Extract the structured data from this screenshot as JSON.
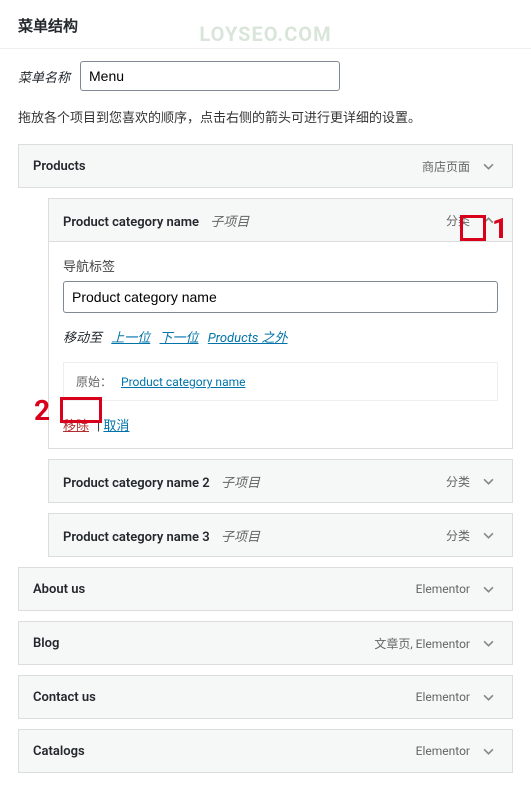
{
  "watermark": "LOYSEO.COM",
  "header": {
    "title": "菜单结构"
  },
  "menuNameLabel": "菜单名称",
  "menuNameValue": "Menu",
  "instructions": "拖放各个项目到您喜欢的顺序，点击右侧的箭头可进行更详细的设置。",
  "items": [
    {
      "title": "Products",
      "type": "商店页面",
      "depth": 0,
      "expanded": false
    },
    {
      "title": "Product category name",
      "subLabel": "子项目",
      "type": "分类",
      "depth": 1,
      "expanded": true,
      "settings": {
        "navLabel": "导航标签",
        "navValue": "Product category name",
        "moveLabel": "移动至",
        "moveLinks": [
          "上一位",
          "下一位",
          "Products 之外"
        ],
        "originalLabel": "原始：",
        "originalLink": "Product category name",
        "removeText": "移除",
        "cancelText": "取消"
      }
    },
    {
      "title": "Product category name 2",
      "subLabel": "子项目",
      "type": "分类",
      "depth": 1,
      "expanded": false
    },
    {
      "title": "Product category name 3",
      "subLabel": "子项目",
      "type": "分类",
      "depth": 1,
      "expanded": false
    },
    {
      "title": "About us",
      "type": "Elementor",
      "depth": 0,
      "expanded": false
    },
    {
      "title": "Blog",
      "type": "文章页, Elementor",
      "depth": 0,
      "expanded": false
    },
    {
      "title": "Contact us",
      "type": "Elementor",
      "depth": 0,
      "expanded": false
    },
    {
      "title": "Catalogs",
      "type": "Elementor",
      "depth": 0,
      "expanded": false
    }
  ],
  "annotations": {
    "one": "1",
    "two": "2"
  }
}
